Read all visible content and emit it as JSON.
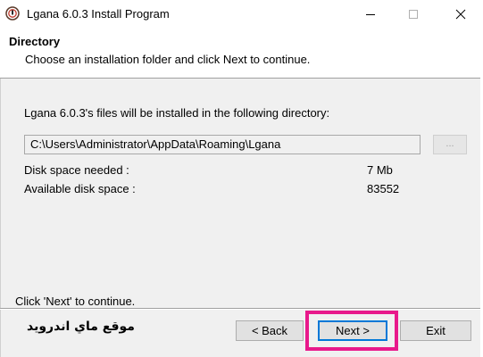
{
  "window": {
    "title": "Lgana 6.0.3 Install Program",
    "app_icon": "installer-app-icon",
    "controls": {
      "minimize": "minimize-icon",
      "maximize": "maximize-icon",
      "close": "close-icon"
    }
  },
  "header": {
    "title": "Directory",
    "subtitle": "Choose an installation folder and click Next to continue."
  },
  "main": {
    "directory_label": "Lgana 6.0.3's files will be installed in the following directory:",
    "path_value": "C:\\Users\\Administrator\\AppData\\Roaming\\Lgana",
    "browse_label": "...",
    "disk_needed_label": "Disk space needed :",
    "disk_needed_value": "7 Mb",
    "disk_available_label": "Available disk space :",
    "disk_available_value": "83552"
  },
  "status": {
    "text": "Click 'Next' to continue."
  },
  "watermark": {
    "text": "موقع ماي اندرويد"
  },
  "buttons": {
    "back": "< Back",
    "next": "Next >",
    "exit": "Exit"
  },
  "colors": {
    "highlight": "#e8198b",
    "focus": "#0078d7",
    "panel": "#f0f0f0"
  }
}
